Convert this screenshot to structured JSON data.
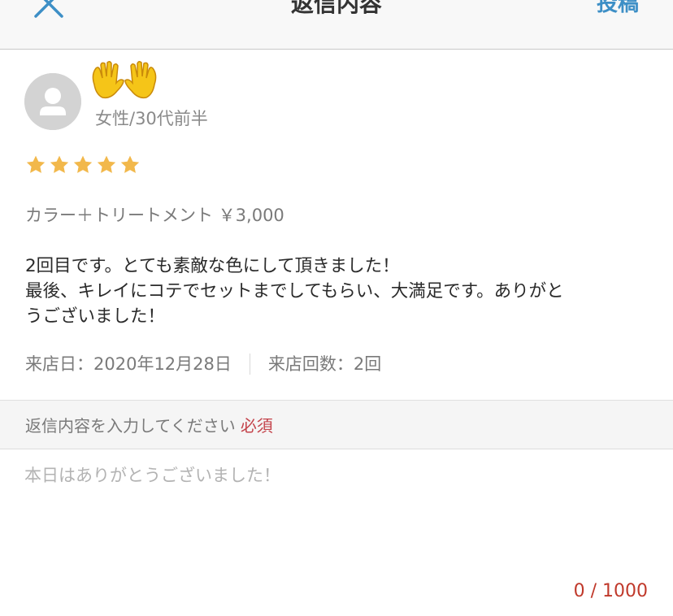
{
  "header": {
    "title": "返信内容",
    "post_label": "投稿"
  },
  "review": {
    "user_name": "👐",
    "user_meta": "女性/30代前半",
    "rating": 5,
    "menu": "カラー＋トリートメント ￥3,000",
    "body_lines": [
      "2回目です。とても素敵な色にして頂きました！",
      "最後、キレイにコテでセットまでしてもらい、大満足です。ありがと",
      "うございました！"
    ],
    "visit_date": "来店日：2020年12月28日",
    "visit_count": "来店回数：2回"
  },
  "reply": {
    "label": "返信内容を入力してください",
    "required_label": "必須",
    "placeholder": "本日はありがとうございました！",
    "value": "",
    "char_count": "0 / 1000"
  },
  "colors": {
    "accent": "#3d8fc6",
    "star": "#f2b84b",
    "required": "#c4434b",
    "counter": "#c0392b"
  },
  "icons": {
    "close": "close-icon",
    "avatar": "user-avatar-icon",
    "star": "star-icon"
  }
}
